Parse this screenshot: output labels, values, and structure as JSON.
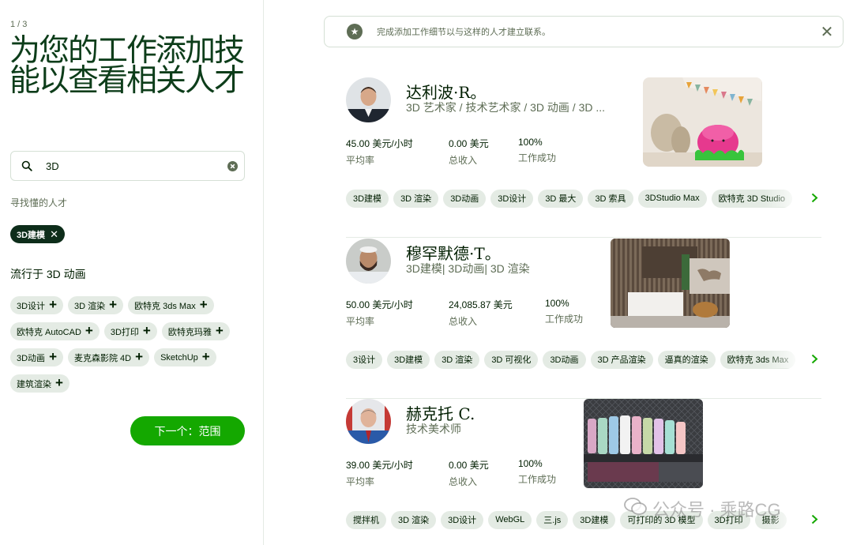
{
  "left": {
    "step": "1 / 3",
    "title": "为您的工作添加技能以查看相关人才",
    "search_value": "3D",
    "find_label": "寻找懂的人才",
    "selected_skill": "3D建模",
    "popular_label": "流行于 3D 动画",
    "popular_skills": [
      "3D设计",
      "3D 渲染",
      "欧特克 3ds Max",
      "欧特克 AutoCAD",
      "3D打印",
      "欧特克玛雅",
      "3D动画",
      "麦克森影院 4D",
      "SketchUp",
      "建筑渲染"
    ],
    "next_button": "下一个：范围"
  },
  "banner": {
    "text": "完成添加工作细节以与这样的人才建立联系。"
  },
  "talents": [
    {
      "name": "达利波·R。",
      "role": "3D 艺术家 / 技术艺术家 / 3D 动画 / 3D ...",
      "rate": "45.00 美元/小时",
      "rate_label": "平均率",
      "earned": "0.00 美元",
      "earned_label": "总收入",
      "success": "100%",
      "success_label": "工作成功",
      "skills": [
        "3D建模",
        "3D 渲染",
        "3D动画",
        "3D设计",
        "3D 最大",
        "3D 索具",
        "3DStudio Max",
        "欧特克 3D Studio"
      ]
    },
    {
      "name": "穆罕默德·T。",
      "role": "3D建模| 3D动画| 3D 渲染",
      "rate": "50.00 美元/小时",
      "rate_label": "平均率",
      "earned": "24,085.87 美元",
      "earned_label": "总收入",
      "success": "100%",
      "success_label": "工作成功",
      "skills": [
        "3设计",
        "3D建模",
        "3D 渲染",
        "3D 可视化",
        "3D动画",
        "3D 产品渲染",
        "逼真的渲染",
        "欧特克 3ds Max"
      ]
    },
    {
      "name": "赫克托 C.",
      "role": "技术美术师",
      "rate": "39.00 美元/小时",
      "rate_label": "平均率",
      "earned": "0.00 美元",
      "earned_label": "总收入",
      "success": "100%",
      "success_label": "工作成功",
      "skills": [
        "搅拌机",
        "3D 渲染",
        "3D设计",
        "WebGL",
        "三.js",
        "3D建模",
        "可打印的 3D 模型",
        "3D打印",
        "摄影"
      ]
    }
  ],
  "watermark": "公众号 · 乘路CG",
  "colors": {
    "accent": "#14a800",
    "dark_green": "#0d3d1a",
    "chip_bg": "#e4ebe4",
    "muted": "#5e6d55"
  }
}
